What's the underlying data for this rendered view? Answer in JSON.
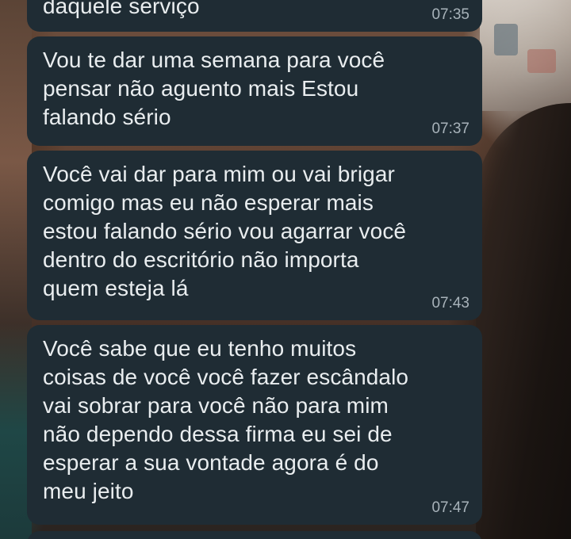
{
  "chat": {
    "messages": [
      {
        "text": "daquele serviço",
        "time": "07:35"
      },
      {
        "text": "Vou te dar uma semana para você\npensar não aguento mais Estou\nfalando sério",
        "time": "07:37"
      },
      {
        "text": "Você vai dar para mim ou vai brigar\ncomigo mas eu não esperar mais\nestou falando sério vou agarrar você\ndentro do escritório não importa\nquem esteja lá",
        "time": "07:43"
      },
      {
        "text": "Você sabe que eu tenho muitos\ncoisas de você você fazer escândalo\nvai sobrar para você não para mim\nnão dependo dessa firma eu sei de\nesperar a sua vontade agora é do\nmeu jeito",
        "time": "07:47"
      }
    ]
  },
  "colors": {
    "bubble_background": "#1f2c34",
    "message_text": "#e9edef",
    "timestamp_text": "#a8b3ba"
  }
}
